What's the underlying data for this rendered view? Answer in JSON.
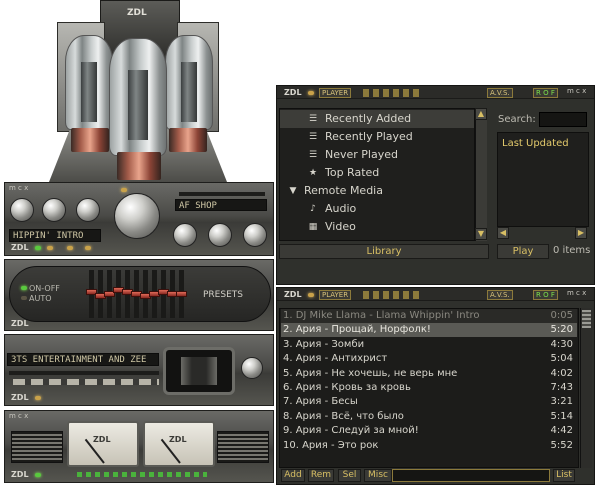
{
  "amp": {
    "brand": "ZDL",
    "tubes": 3
  },
  "eq_unit": {
    "logo": "ZDL",
    "display_track": "HIPPIN' INTRO",
    "mode_display": "AF SHOP",
    "corner_label": "m c x"
  },
  "eq_sliders": {
    "onoff_label": "ON-OFF",
    "auto_label": "AUTO",
    "presets_label": "PRESETS",
    "logo": "ZDL",
    "bands": [
      0.55,
      0.45,
      0.5,
      0.6,
      0.55,
      0.5,
      0.45,
      0.5,
      0.55,
      0.5,
      0.5
    ]
  },
  "marquee": {
    "text": "3TS ENTERTAINMENT AND ZEE",
    "logo": "ZDL"
  },
  "vu_unit": {
    "logo": "ZDL",
    "meter_brand": "ZDL",
    "corner_label": "m c x"
  },
  "library": {
    "logo": "ZDL",
    "player_label": "PLAYER",
    "avs_label": "A.V.S.",
    "rof_label": "R O F",
    "corner_label": "m c x",
    "items": [
      {
        "label": "Recently Added",
        "icon": "list-icon",
        "level": 1
      },
      {
        "label": "Recently Played",
        "icon": "list-icon",
        "level": 1
      },
      {
        "label": "Never Played",
        "icon": "list-icon",
        "level": 1
      },
      {
        "label": "Top Rated",
        "icon": "star-list-icon",
        "level": 1
      },
      {
        "label": "Remote Media",
        "icon": "triangle-down-icon",
        "level": 0
      },
      {
        "label": "Audio",
        "icon": "speaker-icon",
        "level": 1
      },
      {
        "label": "Video",
        "icon": "film-icon",
        "level": 1
      }
    ],
    "library_button": "Library",
    "search_label": "Search:",
    "search_value": "",
    "right_list": [
      "Last Updated"
    ],
    "play_button": "Play",
    "items_count": "0 items"
  },
  "playlist": {
    "logo": "ZDL",
    "player_label": "PLAYER",
    "avs_label": "A.V.S.",
    "rof_label": "R O F",
    "corner_label": "m c x",
    "tracks": [
      {
        "title": "1. DJ Mike Llama - Llama Whippin' Intro",
        "duration": "0:05"
      },
      {
        "title": "2. Ария - Прощай, Норфолк!",
        "duration": "5:20"
      },
      {
        "title": "3. Ария - Зомби",
        "duration": "4:30"
      },
      {
        "title": "4. Ария - Антихрист",
        "duration": "5:04"
      },
      {
        "title": "5. Ария - Не хочешь, не верь мне",
        "duration": "4:02"
      },
      {
        "title": "6. Ария - Кровь за кровь",
        "duration": "7:43"
      },
      {
        "title": "7. Ария - Бесы",
        "duration": "3:21"
      },
      {
        "title": "8. Ария - Всё, что было",
        "duration": "5:14"
      },
      {
        "title": "9. Ария - Следуй за мной!",
        "duration": "4:42"
      },
      {
        "title": "10. Ария - Это рок",
        "duration": "5:52"
      }
    ],
    "buttons": {
      "add": "Add",
      "rem": "Rem",
      "sel": "Sel",
      "misc": "Misc",
      "list": "List"
    }
  },
  "colors": {
    "accent": "#d8bf64",
    "green": "#59c93e",
    "panel": "#2f302c"
  }
}
